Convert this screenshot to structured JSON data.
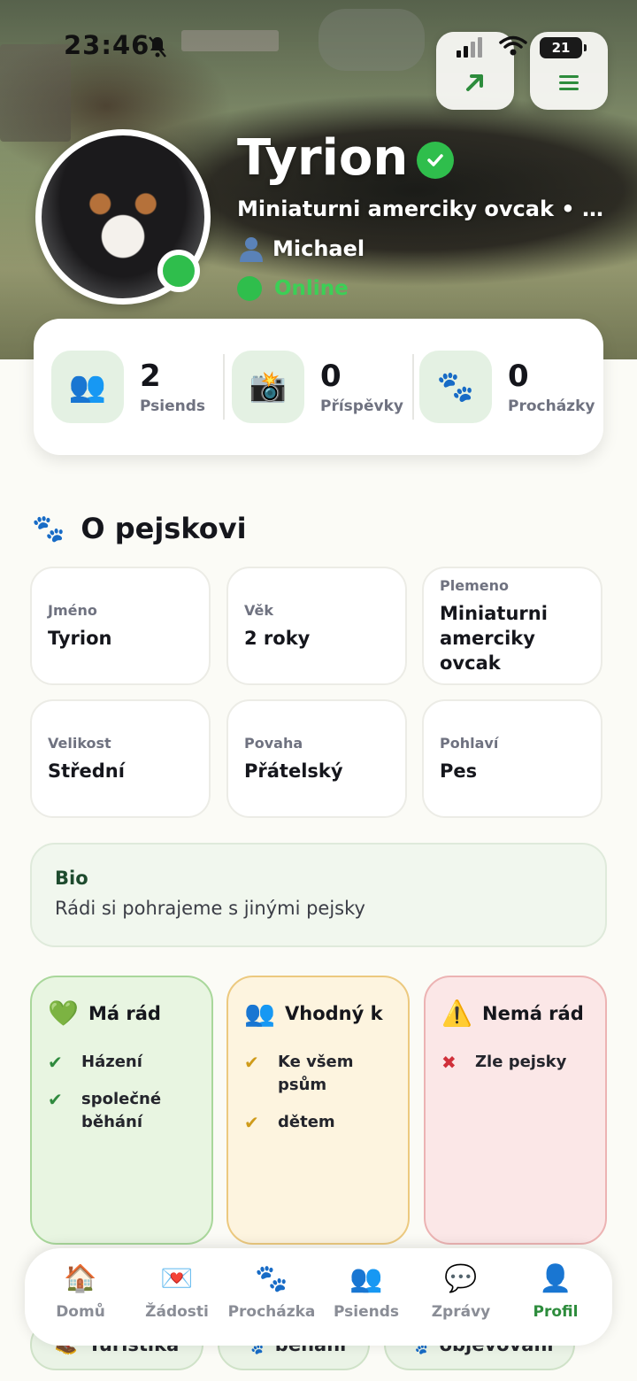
{
  "status_bar": {
    "time": "23:46",
    "battery": "21"
  },
  "profile": {
    "name": "Tyrion",
    "subtitle": "Miniaturni amerciky ovcak • 2...",
    "owner": "Michael",
    "status": "Online"
  },
  "stats": [
    {
      "icon": "friends-icon",
      "value": "2",
      "label": "Psiends"
    },
    {
      "icon": "camera-icon",
      "value": "0",
      "label": "Příspěvky"
    },
    {
      "icon": "paw-icon",
      "value": "0",
      "label": "Procházky"
    }
  ],
  "about": {
    "title": "O pejskovi",
    "fields": [
      {
        "label": "Jméno",
        "value": "Tyrion"
      },
      {
        "label": "Věk",
        "value": "2 roky"
      },
      {
        "label": "Plemeno",
        "value": "Miniaturni amerciky ovcak"
      },
      {
        "label": "Velikost",
        "value": "Střední"
      },
      {
        "label": "Povaha",
        "value": "Přátelský"
      },
      {
        "label": "Pohlaví",
        "value": "Pes"
      }
    ]
  },
  "bio": {
    "label": "Bio",
    "text": "Rádi si pohrajeme s jinými pejsky"
  },
  "likes": {
    "title": "Má rád",
    "items": [
      "Házení",
      "společné běhání"
    ]
  },
  "suitable": {
    "title": "Vhodný k",
    "items": [
      "Ke všem psům",
      "dětem"
    ]
  },
  "dislikes": {
    "title": "Nemá rád",
    "items": [
      "Zle pejsky"
    ]
  },
  "chips": [
    "Turistika",
    "běhání",
    "objevování"
  ],
  "nav": [
    {
      "icon": "home-icon",
      "label": "Domů"
    },
    {
      "icon": "envelope-icon",
      "label": "Žádosti"
    },
    {
      "icon": "paw-icon",
      "label": "Procházka"
    },
    {
      "icon": "friends-icon",
      "label": "Psiends"
    },
    {
      "icon": "chat-icon",
      "label": "Zprávy"
    },
    {
      "icon": "profile-icon",
      "label": "Profil",
      "active": true
    }
  ],
  "colors": {
    "accent": "#2fbe4c",
    "nav_active": "#2d8c3c"
  }
}
